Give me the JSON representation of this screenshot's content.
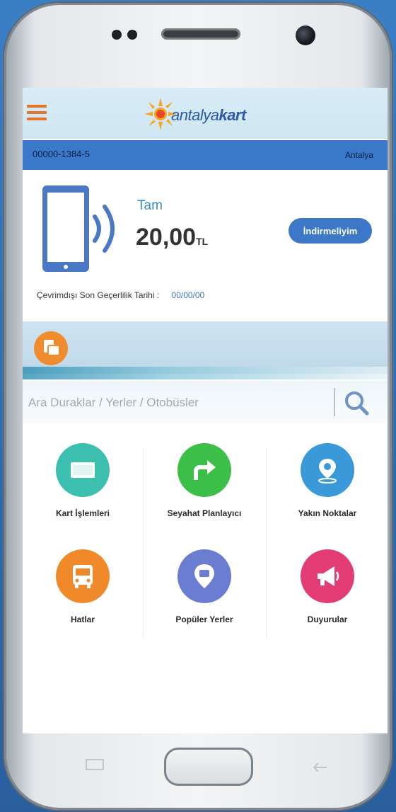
{
  "app": {
    "brand": "antalyakart",
    "brand_light": "antalya",
    "brand_bold": "kart"
  },
  "card": {
    "number": "00000-1384-5",
    "city": "Antalya"
  },
  "balance": {
    "type": "Tam",
    "amount": "20,00",
    "currency": "TL",
    "download_label": "İndirmeliyim",
    "validity_label": "Çevrimdışı Son Geçerlilik Tarihi :",
    "validity_date": "00/00/00"
  },
  "search": {
    "placeholder": "Ara Duraklar / Yerler / Otobüsler"
  },
  "menu": {
    "items": [
      {
        "label": "Kart İşlemleri",
        "icon": "card-icon",
        "color": "#3dbfb0"
      },
      {
        "label": "Seyahat Planlayıcı",
        "icon": "turn-right-arrow-icon",
        "color": "#3cbf48"
      },
      {
        "label": "Yakın Noktalar",
        "icon": "location-pin-icon",
        "color": "#3a9ad9"
      },
      {
        "label": "Hatlar",
        "icon": "bus-icon",
        "color": "#f0892a"
      },
      {
        "label": "Popüler Yerler",
        "icon": "popular-place-pin-icon",
        "color": "#6a7dd1"
      },
      {
        "label": "Duyurular",
        "icon": "megaphone-icon",
        "color": "#e33b74"
      }
    ]
  },
  "colors": {
    "accent_orange": "#e8732a",
    "card_bar_blue": "#3a78c9",
    "brand_blue": "#2b5aa8"
  }
}
